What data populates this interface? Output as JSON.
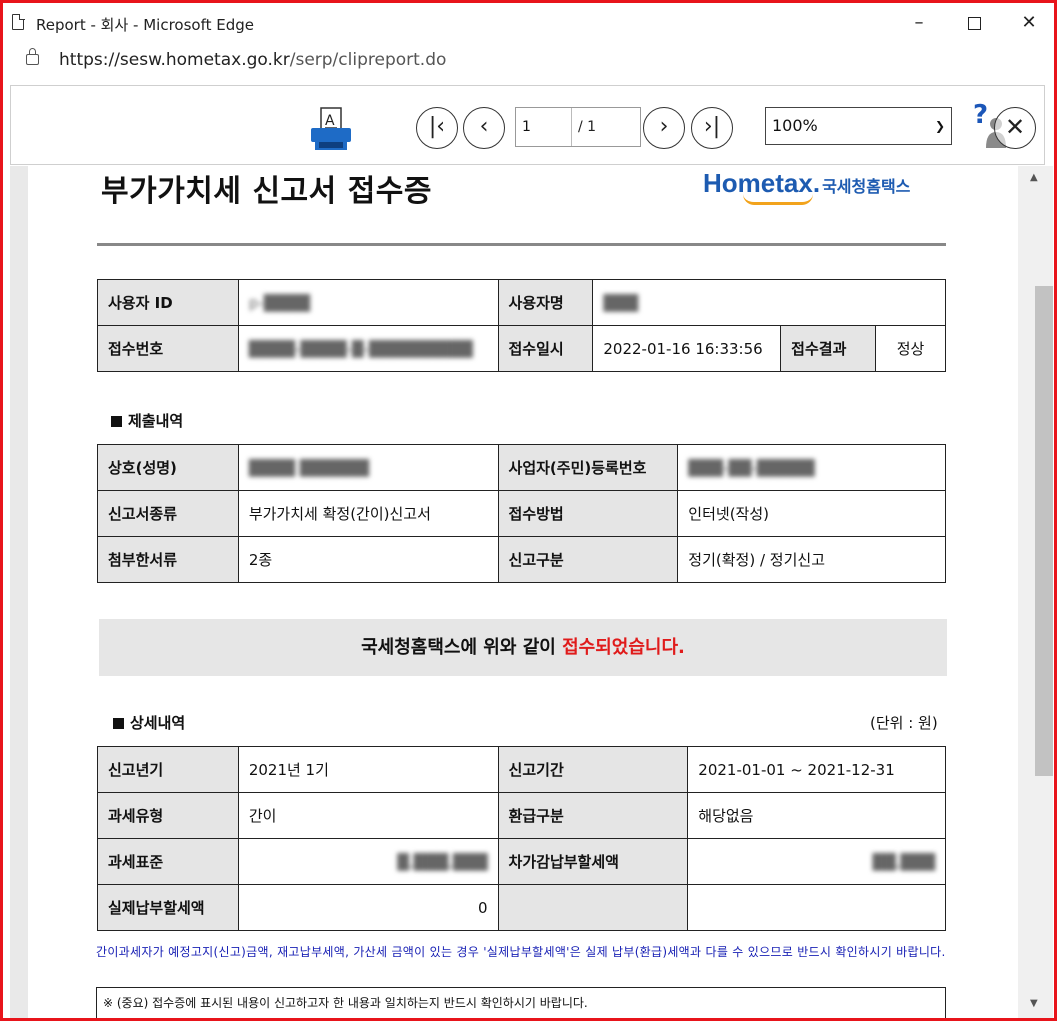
{
  "window": {
    "title": "Report - 회사 - Microsoft Edge",
    "url_domain": "https://sesw.hometax.go.kr",
    "url_path": "/serp/clipreport.do"
  },
  "toolbar": {
    "page_current": "1",
    "page_total": "/ 1",
    "zoom": "100%",
    "help_label": "?",
    "close_label": "✕"
  },
  "report": {
    "title": "부가가치세 신고서 접수증",
    "logo_text_a": "Hom",
    "logo_text_e": "e",
    "logo_text_b": "tax.",
    "logo_korean": "국세청홈택스",
    "user_info": {
      "user_id_label": "사용자 ID",
      "user_id_value": "p-████",
      "user_name_label": "사용자명",
      "user_name_value": "███",
      "receipt_no_label": "접수번호",
      "receipt_no_value": "████-████-█-█████████",
      "receipt_date_label": "접수일시",
      "receipt_date_value": "2022-01-16 16:33:56",
      "receipt_result_label": "접수결과",
      "receipt_result_value": "정상"
    },
    "section_submission": "제출내역",
    "submission": {
      "company_label": "상호(성명)",
      "company_value": "████ ██████",
      "biz_no_label": "사업자(주민)등록번호",
      "biz_no_value": "███-██-█████",
      "form_type_label": "신고서종류",
      "form_type_value": "부가가치세 확정(간이)신고서",
      "method_label": "접수방법",
      "method_value": "인터넷(작성)",
      "attach_label": "첨부한서류",
      "attach_value": "2종",
      "category_label": "신고구분",
      "category_value": "정기(확정) / 정기신고"
    },
    "notice_text": "국세청홈택스에 위와 같이 ",
    "notice_red": "접수되었습니다.",
    "section_detail": "상세내역",
    "unit": "(단위 : 원)",
    "detail": {
      "year_label": "신고년기",
      "year_value": "2021년 1기",
      "period_label": "신고기간",
      "period_value": "2021-01-01  ~  2021-12-31",
      "tax_type_label": "과세유형",
      "tax_type_value": "간이",
      "refund_label": "환급구분",
      "refund_value": "해당없음",
      "tax_base_label": "과세표준",
      "tax_base_value": "█,███,███",
      "net_due_label": "차가감납부할세액",
      "net_due_value": "██,███",
      "actual_due_label": "실제납부할세액",
      "actual_due_value": "0"
    },
    "blue_note": "간이과세자가 예정고지(신고)금액, 재고납부세액, 가산세 금액이 있는 경우 '실제납부할세액'은 실제 납부(환급)세액과 다를 수 있으므로 반드시 확인하시기 바랍니다.",
    "important_note": "※ (중요) 접수증에 표시된 내용이 신고하고자 한 내용과 일치하는지 반드시 확인하시기 바랍니다."
  }
}
